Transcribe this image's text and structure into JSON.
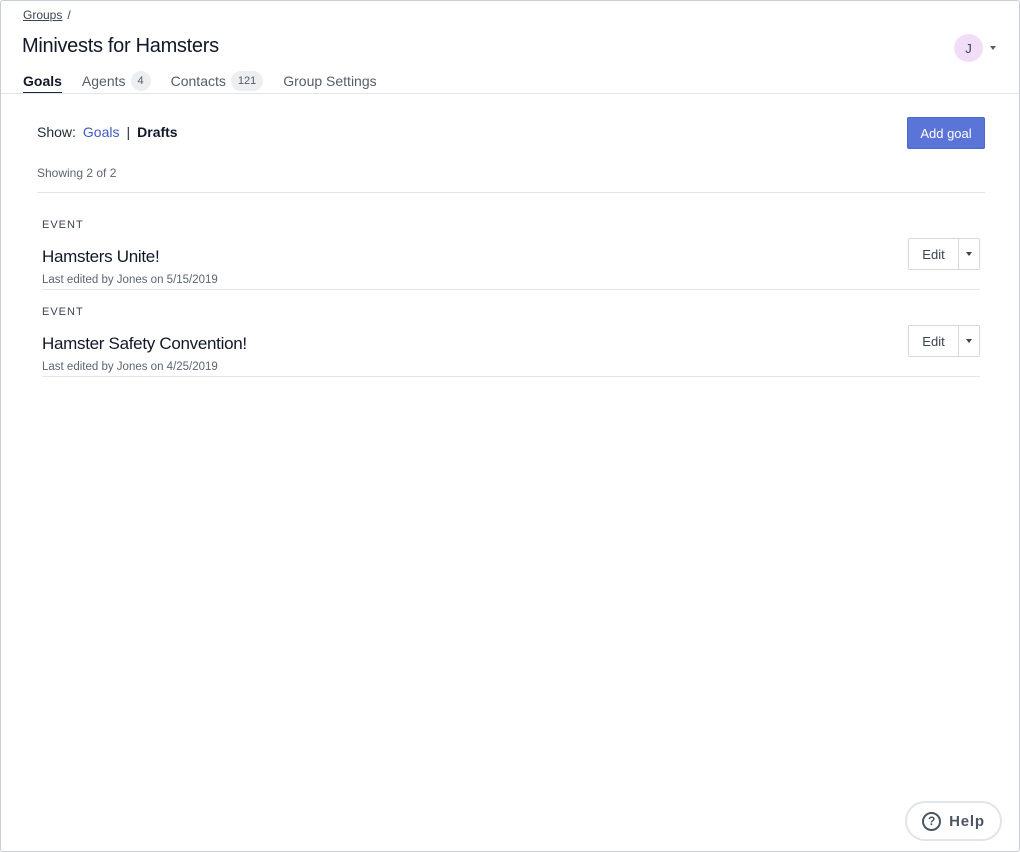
{
  "breadcrumb": {
    "groups_label": "Groups",
    "separator": "/"
  },
  "page_title": "Minivests for Hamsters",
  "user": {
    "avatar_initial": "J"
  },
  "tabs": [
    {
      "label": "Goals",
      "active": true
    },
    {
      "label": "Agents",
      "count": "4"
    },
    {
      "label": "Contacts",
      "count": "121"
    },
    {
      "label": "Group Settings"
    }
  ],
  "filter": {
    "show_label": "Show:",
    "goals_link": "Goals",
    "separator": "|",
    "drafts_link": "Drafts"
  },
  "add_goal_label": "Add goal",
  "showing_text": "Showing 2 of 2",
  "goals": [
    {
      "type": "EVENT",
      "name": "Hamsters Unite!",
      "meta": "Last edited by Jones on 5/15/2019",
      "edit_label": "Edit"
    },
    {
      "type": "EVENT",
      "name": "Hamster Safety Convention!",
      "meta": "Last edited by Jones on 4/25/2019",
      "edit_label": "Edit"
    }
  ],
  "help": {
    "icon": "question-circle-icon",
    "glyph": "?",
    "label": "Help"
  },
  "colors": {
    "primary": "#5b74d8",
    "link": "#3f5ac7",
    "avatar_bg": "#f1ddf7"
  }
}
